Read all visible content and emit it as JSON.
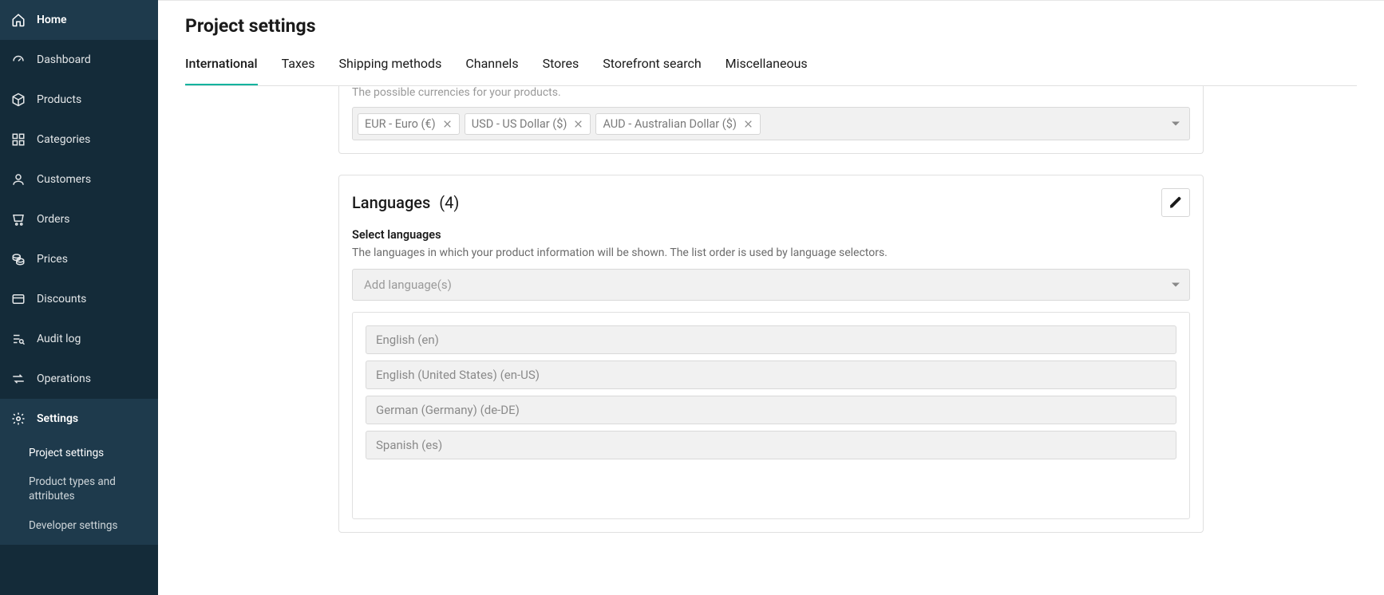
{
  "sidebar": {
    "items": [
      {
        "id": "home",
        "label": "Home"
      },
      {
        "id": "dashboard",
        "label": "Dashboard"
      },
      {
        "id": "products",
        "label": "Products"
      },
      {
        "id": "categories",
        "label": "Categories"
      },
      {
        "id": "customers",
        "label": "Customers"
      },
      {
        "id": "orders",
        "label": "Orders"
      },
      {
        "id": "prices",
        "label": "Prices"
      },
      {
        "id": "discounts",
        "label": "Discounts"
      },
      {
        "id": "audit",
        "label": "Audit log"
      },
      {
        "id": "operations",
        "label": "Operations"
      },
      {
        "id": "settings",
        "label": "Settings"
      }
    ],
    "settings_children": [
      {
        "id": "project-settings",
        "label": "Project settings"
      },
      {
        "id": "product-types",
        "label": "Product types and attributes"
      },
      {
        "id": "developer-settings",
        "label": "Developer settings"
      }
    ]
  },
  "header": {
    "title": "Project settings",
    "tabs": [
      "International",
      "Taxes",
      "Shipping methods",
      "Channels",
      "Stores",
      "Storefront search",
      "Miscellaneous"
    ]
  },
  "currencies": {
    "helper": "The possible currencies for your products.",
    "chips": [
      "EUR - Euro (€)",
      "USD - US Dollar ($)",
      "AUD - Australian Dollar ($)"
    ]
  },
  "languages": {
    "title": "Languages",
    "count": "(4)",
    "label": "Select languages",
    "desc": "The languages in which your product information will be shown.  The list order is used by language selectors.",
    "placeholder": "Add language(s)",
    "list": [
      "English (en)",
      "English (United States) (en-US)",
      "German (Germany) (de-DE)",
      "Spanish (es)"
    ]
  }
}
